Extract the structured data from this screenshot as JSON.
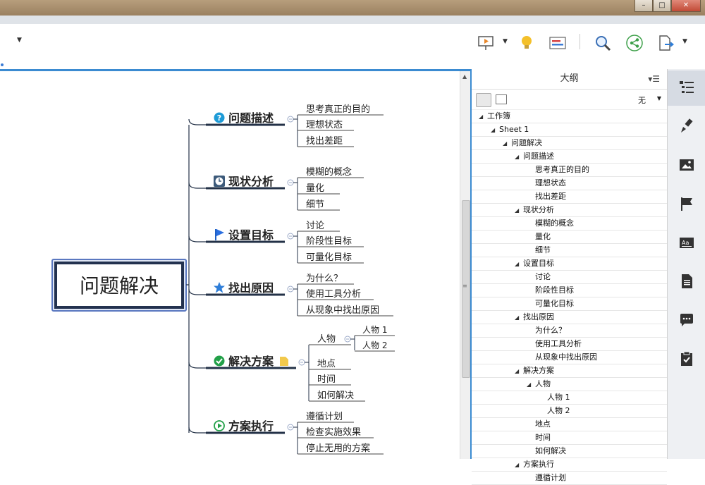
{
  "window": {
    "min": "–",
    "max": "□",
    "close": "✕"
  },
  "mindmap": {
    "root": "问题解决",
    "topics": [
      {
        "label": "问题描述",
        "icon": "question-icon",
        "children": [
          "思考真正的目的",
          "理想状态",
          "找出差距"
        ]
      },
      {
        "label": "现状分析",
        "icon": "clock-icon",
        "children": [
          "模糊的概念",
          "量化",
          "细节"
        ]
      },
      {
        "label": "设置目标",
        "icon": "flag-icon",
        "children": [
          "讨论",
          "阶段性目标",
          "可量化目标"
        ]
      },
      {
        "label": "找出原因",
        "icon": "star-icon",
        "children": [
          "为什么？",
          "使用工具分析",
          "从现象中找出原因"
        ]
      },
      {
        "label": "解决方案",
        "icon": "check-icon",
        "children": [
          "人物",
          "地点",
          "时间",
          "如何解决"
        ],
        "sub": [
          "人物 1",
          "人物 2"
        ]
      },
      {
        "label": "方案执行",
        "icon": "play-icon",
        "children": [
          "遵循计划",
          "检查实施效果",
          "停止无用的方案"
        ]
      }
    ]
  },
  "outline": {
    "title": "大纲",
    "filter": "无",
    "rows": [
      {
        "label": "工作簿",
        "level": 0,
        "open": true
      },
      {
        "label": "Sheet 1",
        "level": 1,
        "open": true
      },
      {
        "label": "问题解决",
        "level": 2,
        "open": true
      },
      {
        "label": "问题描述",
        "level": 3,
        "open": true
      },
      {
        "label": "思考真正的目的",
        "level": 4,
        "open": false
      },
      {
        "label": "理想状态",
        "level": 4,
        "open": false
      },
      {
        "label": "找出差距",
        "level": 4,
        "open": false
      },
      {
        "label": "现状分析",
        "level": 3,
        "open": true
      },
      {
        "label": "模糊的概念",
        "level": 4,
        "open": false
      },
      {
        "label": "量化",
        "level": 4,
        "open": false
      },
      {
        "label": "细节",
        "level": 4,
        "open": false
      },
      {
        "label": "设置目标",
        "level": 3,
        "open": true
      },
      {
        "label": "讨论",
        "level": 4,
        "open": false
      },
      {
        "label": "阶段性目标",
        "level": 4,
        "open": false
      },
      {
        "label": "可量化目标",
        "level": 4,
        "open": false
      },
      {
        "label": "找出原因",
        "level": 3,
        "open": true
      },
      {
        "label": "为什么？",
        "level": 4,
        "open": false
      },
      {
        "label": "使用工具分析",
        "level": 4,
        "open": false
      },
      {
        "label": "从现象中找出原因",
        "level": 4,
        "open": false
      },
      {
        "label": "解决方案",
        "level": 3,
        "open": true
      },
      {
        "label": "人物",
        "level": 4,
        "open": true
      },
      {
        "label": "人物 1",
        "level": 5,
        "open": false
      },
      {
        "label": "人物 2",
        "level": 5,
        "open": false
      },
      {
        "label": "地点",
        "level": 4,
        "open": false
      },
      {
        "label": "时间",
        "level": 4,
        "open": false
      },
      {
        "label": "如何解决",
        "level": 4,
        "open": false
      },
      {
        "label": "方案执行",
        "level": 3,
        "open": true
      },
      {
        "label": "遵循计划",
        "level": 4,
        "open": false
      }
    ]
  },
  "colors": {
    "accent": "#3b8bd1",
    "root_border": "#3a5aa8",
    "branch": "#233147"
  }
}
